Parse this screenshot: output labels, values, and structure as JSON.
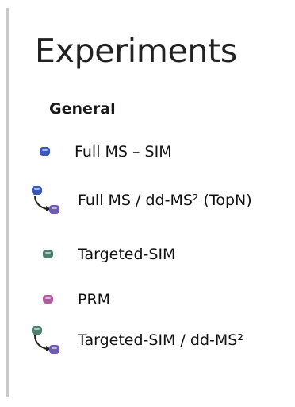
{
  "panel": {
    "title": "Experiments",
    "section_header": "General"
  },
  "experiments": [
    {
      "label": "Full MS – SIM",
      "icon": "full-ms-sim-icon",
      "color": "#3a58b8"
    },
    {
      "label": "Full MS / dd-MS² (TopN)",
      "icon": "full-ms-ddms2-icon",
      "color": "#3a58b8",
      "color2": "#6b5bb5"
    },
    {
      "label": "Targeted-SIM",
      "icon": "targeted-sim-icon",
      "color": "#4f7f70"
    },
    {
      "label": "PRM",
      "icon": "prm-icon",
      "color": "#b05da0"
    },
    {
      "label": "Targeted-SIM / dd-MS²",
      "icon": "targeted-sim-ddms2-icon",
      "color": "#4f7f70",
      "color2": "#6b5bb5"
    }
  ]
}
